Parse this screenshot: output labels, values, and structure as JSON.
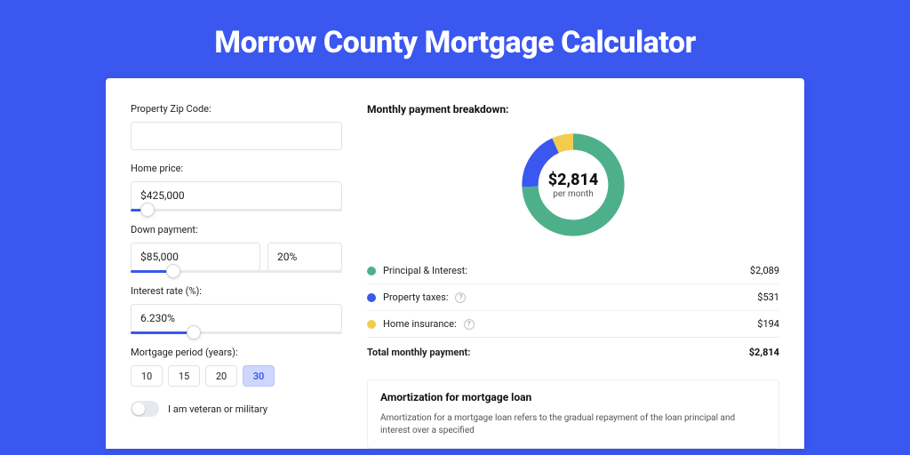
{
  "title": "Morrow County Mortgage Calculator",
  "left": {
    "zip": {
      "label": "Property Zip Code:",
      "value": ""
    },
    "home_price": {
      "label": "Home price:",
      "value": "$425,000",
      "slider_pct": 8
    },
    "down_payment": {
      "label": "Down payment:",
      "value": "$85,000",
      "pct": "20%",
      "slider_pct": 20
    },
    "interest": {
      "label": "Interest rate (%):",
      "value": "6.230%",
      "slider_pct": 30
    },
    "period": {
      "label": "Mortgage period (years):",
      "options": [
        "10",
        "15",
        "20",
        "30"
      ],
      "active": "30"
    },
    "veteran": {
      "label": "I am veteran or military",
      "on": false
    }
  },
  "right": {
    "breakdown_title": "Monthly payment breakdown:",
    "donut": {
      "amount": "$2,814",
      "sub": "per month"
    },
    "rows": [
      {
        "color": "green",
        "label": "Principal & Interest:",
        "info": false,
        "value": "$2,089"
      },
      {
        "color": "blue",
        "label": "Property taxes:",
        "info": true,
        "value": "$531"
      },
      {
        "color": "yellow",
        "label": "Home insurance:",
        "info": true,
        "value": "$194"
      }
    ],
    "total": {
      "label": "Total monthly payment:",
      "value": "$2,814"
    },
    "amort": {
      "title": "Amortization for mortgage loan",
      "text": "Amortization for a mortgage loan refers to the gradual repayment of the loan principal and interest over a specified"
    }
  },
  "chart_data": {
    "type": "pie",
    "title": "Monthly payment breakdown",
    "categories": [
      "Principal & Interest",
      "Property taxes",
      "Home insurance"
    ],
    "values": [
      2089,
      531,
      194
    ],
    "total": 2814,
    "colors": [
      "#4eb08b",
      "#3a57ef",
      "#f3cc4e"
    ]
  }
}
